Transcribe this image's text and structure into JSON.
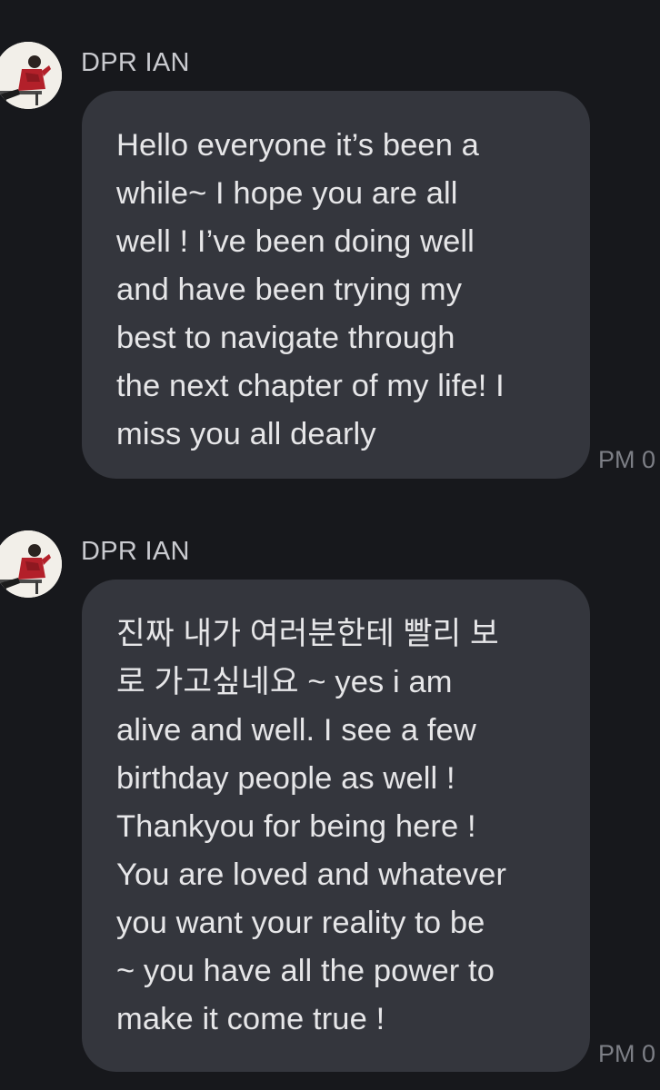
{
  "messages": [
    {
      "sender": "DPR IAN",
      "lines": [
        "Hello everyone it’s been a",
        "while~ I hope you are all",
        "well ! I’ve been doing well",
        "and have been trying my",
        "best to navigate through",
        "the next chapter of my life! I",
        "miss you all dearly"
      ],
      "time": "PM 0"
    },
    {
      "sender": "DPR IAN",
      "lines": [
        "진짜 내가 여러분한테 빨리 보",
        "로 가고싶네요 ~ yes i am",
        "alive and well. I see a few",
        "birthday people as well !",
        "Thankyou for being here !",
        "You are loved and whatever",
        "you want your reality to be",
        "~ you have all the power to",
        "make it come true !"
      ],
      "time": "PM 0"
    }
  ],
  "colors": {
    "background": "#17181c",
    "bubble": "#34363d",
    "text": "#e6e6e8",
    "sender": "#c9cacf",
    "timestamp": "#7d7f86"
  }
}
